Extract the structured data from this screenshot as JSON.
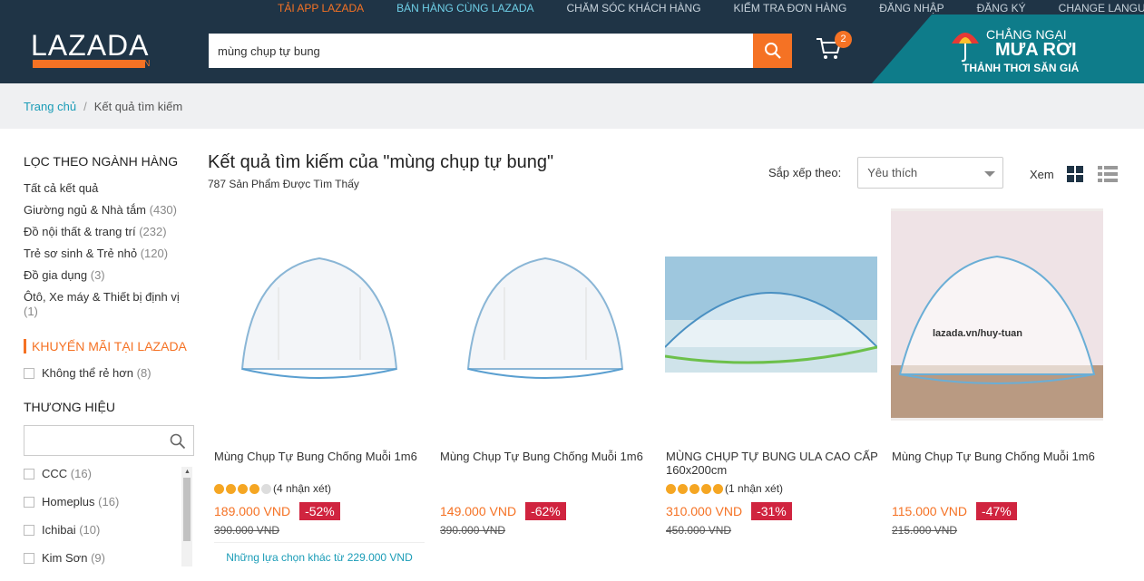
{
  "colors": {
    "accent": "#f57224",
    "header_bg": "#1f3446",
    "link": "#1a9cb7",
    "discount_bg": "#d0243f"
  },
  "toplinks": [
    {
      "label": "TẢI APP LAZADA",
      "style": "orange"
    },
    {
      "label": "BÁN HÀNG CÙNG LAZADA",
      "style": "teal"
    },
    {
      "label": "CHĂM SÓC KHÁCH HÀNG",
      "style": "plain"
    },
    {
      "label": "KIỂM TRA ĐƠN HÀNG",
      "style": "plain"
    },
    {
      "label": "ĐĂNG NHẬP",
      "style": "plain"
    },
    {
      "label": "ĐĂNG KÝ",
      "style": "plain"
    },
    {
      "label": "CHANGE LANGUAGE",
      "style": "plain"
    }
  ],
  "header": {
    "logo_text": "LAZADA",
    "logo_suffix": ".VN",
    "search_value": "mùng chụp tự bung",
    "cart_count": "2",
    "promo_line1": "CHẲNG NGẠI",
    "promo_line2": "MƯA RƠI",
    "promo_line3": "THẢNH THƠI SĂN GIÁ"
  },
  "breadcrumb": {
    "home": "Trang chủ",
    "separator": "/",
    "current": "Kết quả tìm kiếm"
  },
  "sidebar": {
    "category_title": "LỌC THEO NGÀNH HÀNG",
    "all_results": "Tất cả kết quả",
    "categories": [
      {
        "label": "Giường ngủ & Nhà tắm",
        "count": "(430)"
      },
      {
        "label": "Đồ nội thất & trang trí",
        "count": "(232)"
      },
      {
        "label": "Trẻ sơ sinh & Trẻ nhỏ",
        "count": "(120)"
      },
      {
        "label": "Đồ gia dụng",
        "count": "(3)"
      },
      {
        "label": "Ôtô, Xe máy & Thiết bị định vị",
        "count": "(1)"
      }
    ],
    "promo_title": "KHUYẾN MÃI TẠI LAZADA",
    "promo_filter": {
      "label": "Không thể rẻ hơn",
      "count": "(8)"
    },
    "brand_title": "THƯƠNG HIỆU",
    "brands": [
      {
        "label": "CCC",
        "count": "(16)"
      },
      {
        "label": "Homeplus",
        "count": "(16)"
      },
      {
        "label": "Ichibai",
        "count": "(10)"
      },
      {
        "label": "Kim Sơn",
        "count": "(9)"
      }
    ]
  },
  "results": {
    "title": "Kết quả tìm kiếm của \"mùng chụp tự bung\"",
    "found": "787 Sản Phẩm Được Tìm Thấy",
    "sort_label": "Sắp xếp theo:",
    "sort_value": "Yêu thích",
    "view_label": "Xem"
  },
  "products": [
    {
      "name": "Mùng Chụp Tự Bung Chống Muỗi 1m6",
      "stars": 4,
      "reviews": "(4 nhận xét)",
      "price": "189.000 VND",
      "discount": "-52%",
      "old_price": "390.000 VND",
      "more": "Những lựa chọn khác từ 229.000 VND"
    },
    {
      "name": "Mùng Chụp Tự Bung Chống Muỗi 1m6",
      "stars": 0,
      "reviews": "",
      "price": "149.000 VND",
      "discount": "-62%",
      "old_price": "390.000 VND",
      "more": ""
    },
    {
      "name": "MÙNG CHỤP TỰ BUNG ULA CAO CẤP 160x200cm",
      "stars": 5,
      "reviews": "(1 nhận xét)",
      "price": "310.000 VND",
      "discount": "-31%",
      "old_price": "450.000 VND",
      "more": ""
    },
    {
      "name": "Mùng Chụp Tự Bung Chống Muỗi 1m6",
      "stars": 0,
      "reviews": "",
      "price": "115.000 VND",
      "discount": "-47%",
      "old_price": "215.000 VND",
      "more": "",
      "watermark": "lazada.vn/huy-tuan"
    }
  ]
}
